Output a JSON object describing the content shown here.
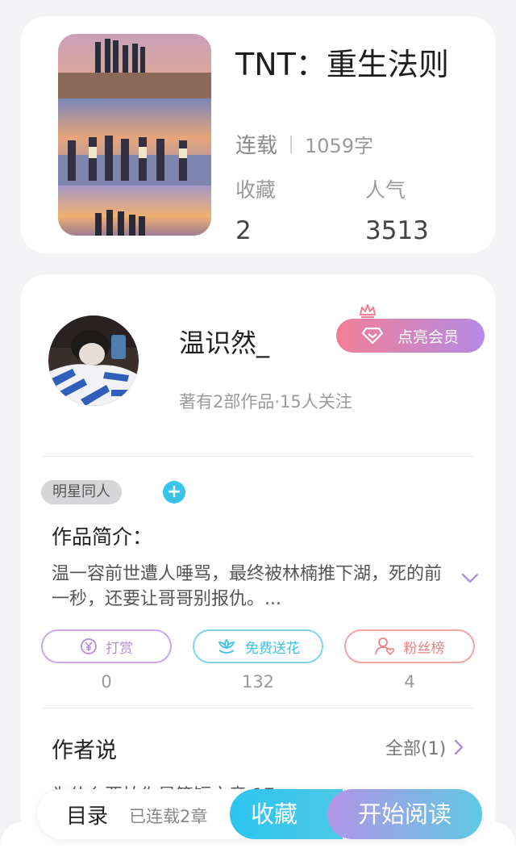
{
  "book": {
    "title": "TNT：重生法则",
    "status": "连载",
    "word_count": "1059字",
    "stats": [
      {
        "label": "收藏",
        "value": "2"
      },
      {
        "label": "人气",
        "value": "3513"
      }
    ]
  },
  "author": {
    "name": "温识然_",
    "subtitle": "著有2部作品·15人关注",
    "vip_label": "点亮会员"
  },
  "tags": [
    "明星同人"
  ],
  "intro": {
    "heading": "作品简介：",
    "text": "温一容前世遭人唾骂，最终被林楠推下湖，死的前一秒，还要让哥哥别报仇。..."
  },
  "actions": [
    {
      "label": "打赏",
      "count": "0",
      "color": "#b48ce0",
      "icon": "yen-coin-icon"
    },
    {
      "label": "免费送花",
      "count": "132",
      "color": "#3cc4e6",
      "icon": "flower-icon"
    },
    {
      "label": "粉丝榜",
      "count": "4",
      "color": "#ee7f86",
      "icon": "fan-user-icon"
    }
  ],
  "author_says": {
    "heading": "作者说",
    "all_label": "全部(1)",
    "preview": "为什么要拍你是篇短文章 17"
  },
  "bottom_bar": {
    "toc_label": "目录",
    "chapter_status": "已连载2章",
    "favorite_label": "收藏",
    "read_label": "开始阅读"
  },
  "colors": {
    "accent_blue": "#2bc5ef",
    "accent_purple": "#b395e6",
    "vip_pink": "#f27f95"
  }
}
